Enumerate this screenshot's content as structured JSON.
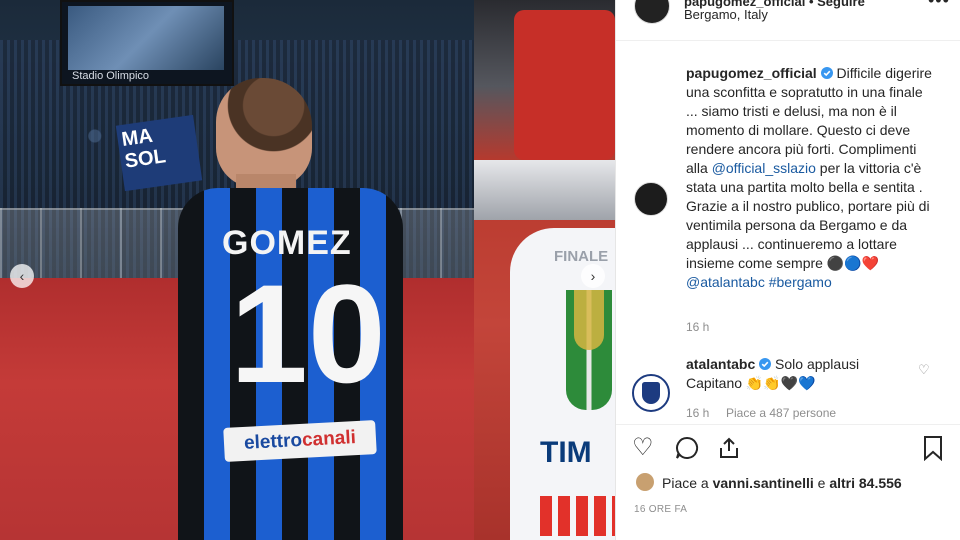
{
  "photo": {
    "stadium_name": "Stadio Olimpico",
    "banner_text": "MA SOL",
    "player_name": "GOMEZ",
    "player_number": "10",
    "sponsor_main": "elettro",
    "sponsor_accent": "canali"
  },
  "photo2": {
    "finale_text": "FINALE",
    "tim_text": "TIM"
  },
  "nav": {
    "prev_icon": "chevron-left-icon",
    "next_icon": "chevron-right-icon"
  },
  "header": {
    "username": "papugomez_official • Seguire",
    "location": "Bergamo, Italy",
    "more_icon": "more-options-icon"
  },
  "caption": {
    "username": "papugomez_official",
    "verified_icon": "verified-badge-icon",
    "text_1": " Difficile digerire una sconfitta e sopratutto in una finale ... siamo tristi e delusi, ma non è il momento di mollare. Questo ci deve rendere ancora più forti. Complimenti alla ",
    "mention_1": "@official_sslazio",
    "text_2": " per la vittoria c'è stata una partita molto bella e sentita .",
    "text_3": "Grazie a il nostro publico, portare più di ventimila persona da Bergamo e da applausi ... continueremo a lottare insieme come sempre ",
    "emojis": "⚫🔵❤️",
    "mention_2": "@atalantabc",
    "hashtag": "#bergamo",
    "time": "16 h"
  },
  "comment": {
    "username": "atalantabc",
    "text": " Solo applausi Capitano 👏👏🖤💙",
    "time": "16 h",
    "likes": "Piace a 487 persone"
  },
  "actions": {
    "like_icon": "heart-icon",
    "comment_icon": "comment-bubble-icon",
    "share_icon": "share-icon",
    "save_icon": "bookmark-icon"
  },
  "likes_summary": {
    "prefix": "Piace a ",
    "user": "vanni.santinelli",
    "middle": " e ",
    "others": "altri 84.556"
  },
  "post_age": "16 ORE FA"
}
